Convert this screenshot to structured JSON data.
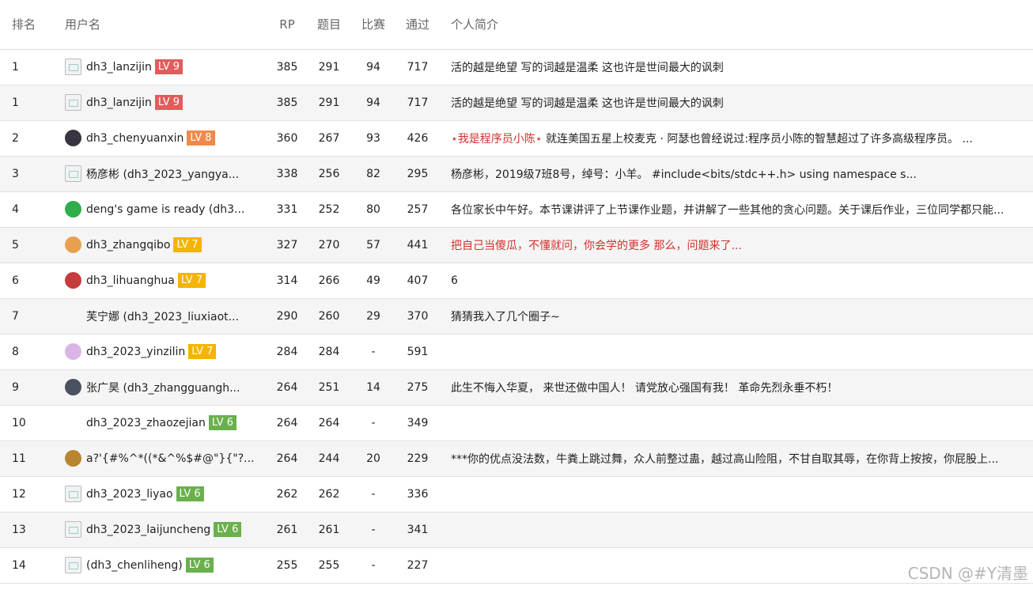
{
  "headers": {
    "rank": "排名",
    "user": "用户名",
    "rp": "RP",
    "problems": "题目",
    "contests": "比赛",
    "passed": "通过",
    "bio": "个人简介"
  },
  "level_colors": {
    "9": "#e05d5d",
    "8": "#f08a4b",
    "7": "#f5b400",
    "6": "#6ab04c"
  },
  "rows": [
    {
      "rank": "1",
      "avatar": "broken",
      "user": "dh3_lanzijin",
      "level": "LV 9",
      "level_color": "#e05d5d",
      "rp": "385",
      "problems": "291",
      "contests": "94",
      "passed": "717",
      "bio": "活的越是绝望 写的词越是温柔 这也许是世间最大的讽刺",
      "bio_prefix": "",
      "bio_color": ""
    },
    {
      "rank": "1",
      "avatar": "broken",
      "user": "dh3_lanzijin",
      "level": "LV 9",
      "level_color": "#e05d5d",
      "rp": "385",
      "problems": "291",
      "contests": "94",
      "passed": "717",
      "bio": "活的越是绝望 写的词越是温柔 这也许是世间最大的讽刺",
      "bio_prefix": "",
      "bio_color": ""
    },
    {
      "rank": "2",
      "avatar": "spider",
      "user": "dh3_chenyuanxin",
      "level": "LV 8",
      "level_color": "#f08a4b",
      "rp": "360",
      "problems": "267",
      "contests": "93",
      "passed": "426",
      "bio_prefix": "⋆我是程序员小陈⋆",
      "bio": " 就连美国五星上校麦克 · 阿瑟也曾经说过:程序员小陈的智慧超过了许多高级程序员。 ...",
      "bio_color": ""
    },
    {
      "rank": "3",
      "avatar": "broken",
      "user": "杨彦彬 (dh3_2023_yangya...",
      "level": "",
      "level_color": "",
      "rp": "338",
      "problems": "256",
      "contests": "82",
      "passed": "295",
      "bio": "杨彦彬，2019级7班8号，绰号：小羊。 #include<bits/stdc++.h> using namespace s...",
      "bio_prefix": "",
      "bio_color": ""
    },
    {
      "rank": "4",
      "avatar": "green",
      "user": "deng's game is ready (dh3...",
      "level": "",
      "level_color": "",
      "rp": "331",
      "problems": "252",
      "contests": "80",
      "passed": "257",
      "bio": "各位家长中午好。本节课讲评了上节课作业题，并讲解了一些其他的贪心问题。关于课后作业，三位同学都只能...",
      "bio_prefix": "",
      "bio_color": ""
    },
    {
      "rank": "5",
      "avatar": "orange",
      "user": "dh3_zhangqibo",
      "level": "LV 7",
      "level_color": "#f5b400",
      "rp": "327",
      "problems": "270",
      "contests": "57",
      "passed": "441",
      "bio": "把自己当傻瓜，不懂就问，你会学的更多 那么，问题来了...",
      "bio_prefix": "",
      "bio_color": "red"
    },
    {
      "rank": "6",
      "avatar": "red",
      "user": "dh3_lihuanghua",
      "level": "LV 7",
      "level_color": "#f5b400",
      "rp": "314",
      "problems": "266",
      "contests": "49",
      "passed": "407",
      "bio": "6",
      "bio_prefix": "",
      "bio_color": ""
    },
    {
      "rank": "7",
      "avatar": "none",
      "user": "芙宁娜 (dh3_2023_liuxiaot...",
      "level": "",
      "level_color": "",
      "rp": "290",
      "problems": "260",
      "contests": "29",
      "passed": "370",
      "bio": "猜猜我入了几个圈子~",
      "bio_prefix": "",
      "bio_color": ""
    },
    {
      "rank": "8",
      "avatar": "flower",
      "user": "dh3_2023_yinzilin",
      "level": "LV 7",
      "level_color": "#f5b400",
      "rp": "284",
      "problems": "284",
      "contests": "-",
      "passed": "591",
      "bio": "",
      "bio_prefix": "",
      "bio_color": ""
    },
    {
      "rank": "9",
      "avatar": "dark",
      "user": "张广昊 (dh3_zhangguangh...",
      "level": "",
      "level_color": "",
      "rp": "264",
      "problems": "251",
      "contests": "14",
      "passed": "275",
      "bio": "此生不悔入华夏， 来世还做中国人！ 请党放心强国有我！ 革命先烈永垂不朽！",
      "bio_prefix": "",
      "bio_color": ""
    },
    {
      "rank": "10",
      "avatar": "none",
      "user": "dh3_2023_zhaozejian",
      "level": "LV 6",
      "level_color": "#6ab04c",
      "rp": "264",
      "problems": "264",
      "contests": "-",
      "passed": "349",
      "bio": "",
      "bio_prefix": "",
      "bio_color": ""
    },
    {
      "rank": "11",
      "avatar": "gold",
      "user": "a?'{#%^*((*&^%$#@\"}{\"?...",
      "level": "",
      "level_color": "",
      "rp": "264",
      "problems": "244",
      "contests": "20",
      "passed": "229",
      "bio": "***你的优点没法数，牛粪上跳过舞，众人前整过蛊，越过高山险阻，不甘自取其辱，在你背上按按，你屁股上...",
      "bio_prefix": "",
      "bio_color": ""
    },
    {
      "rank": "12",
      "avatar": "broken",
      "user": "dh3_2023_liyao",
      "level": "LV 6",
      "level_color": "#6ab04c",
      "rp": "262",
      "problems": "262",
      "contests": "-",
      "passed": "336",
      "bio": "",
      "bio_prefix": "",
      "bio_color": ""
    },
    {
      "rank": "13",
      "avatar": "broken",
      "user": "dh3_2023_laijuncheng",
      "level": "LV 6",
      "level_color": "#6ab04c",
      "rp": "261",
      "problems": "261",
      "contests": "-",
      "passed": "341",
      "bio": "",
      "bio_prefix": "",
      "bio_color": ""
    },
    {
      "rank": "14",
      "avatar": "broken",
      "user": "(dh3_chenliheng)",
      "level": "LV 6",
      "level_color": "#6ab04c",
      "rp": "255",
      "problems": "255",
      "contests": "-",
      "passed": "227",
      "bio": "",
      "bio_prefix": "",
      "bio_color": ""
    }
  ],
  "avatar_colors": {
    "spider": "#3a3340",
    "green": "#2fae4a",
    "orange": "#e8a050",
    "red": "#c63b3b",
    "flower": "#d9b6e6",
    "dark": "#4a5160",
    "gold": "#b8862e"
  },
  "watermark": "CSDN @#Y清墨"
}
